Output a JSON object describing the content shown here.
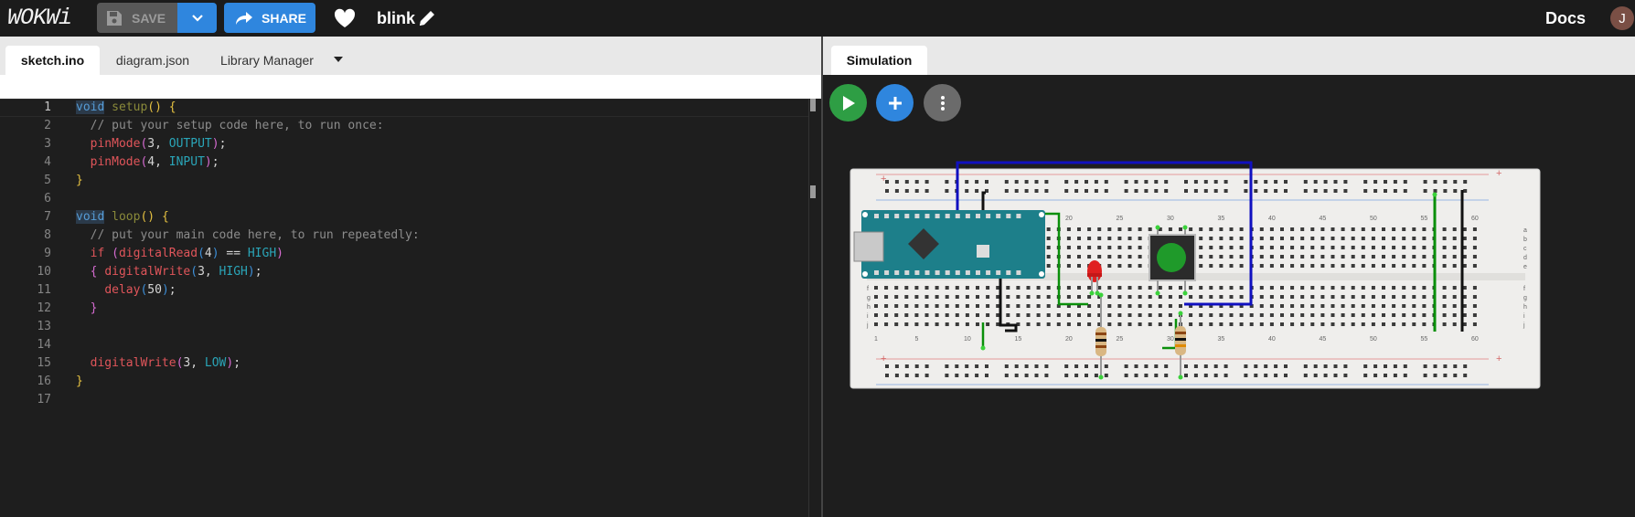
{
  "topbar": {
    "logo": "WOKWi",
    "save_label": "SAVE",
    "share_label": "SHARE",
    "project_name": "blink",
    "docs_label": "Docs",
    "avatar_letter": "J"
  },
  "editor": {
    "tabs": [
      {
        "label": "sketch.ino",
        "active": true
      },
      {
        "label": "diagram.json",
        "active": false
      },
      {
        "label": "Library Manager",
        "active": false
      }
    ],
    "current_line": 1,
    "lines": [
      "void setup() {",
      "  // put your setup code here, to run once:",
      "  pinMode(3, OUTPUT);",
      "  pinMode(4, INPUT);",
      "}",
      "",
      "void loop() {",
      "  // put your main code here, to run repeatedly:",
      "  if (digitalRead(4) == HIGH)",
      "  { digitalWrite(3, HIGH);",
      "    delay(50);",
      "  }",
      "",
      "",
      "  digitalWrite(3, LOW);",
      "}",
      ""
    ]
  },
  "simulation": {
    "tab_label": "Simulation",
    "breadboard_numbers": [
      "1",
      "5",
      "10",
      "15",
      "20",
      "25",
      "30",
      "35",
      "40",
      "45",
      "50",
      "55",
      "60"
    ],
    "breadboard_rows_top": [
      "a",
      "b",
      "c",
      "d",
      "e"
    ],
    "breadboard_rows_bottom": [
      "f",
      "g",
      "h",
      "i",
      "j"
    ],
    "colors": {
      "play": "#2e9e44",
      "add": "#2f86de",
      "more": "#6b6b6b",
      "board": "#1d7f8a",
      "led": "#e02020",
      "button_cap": "#1f9a2a"
    }
  }
}
